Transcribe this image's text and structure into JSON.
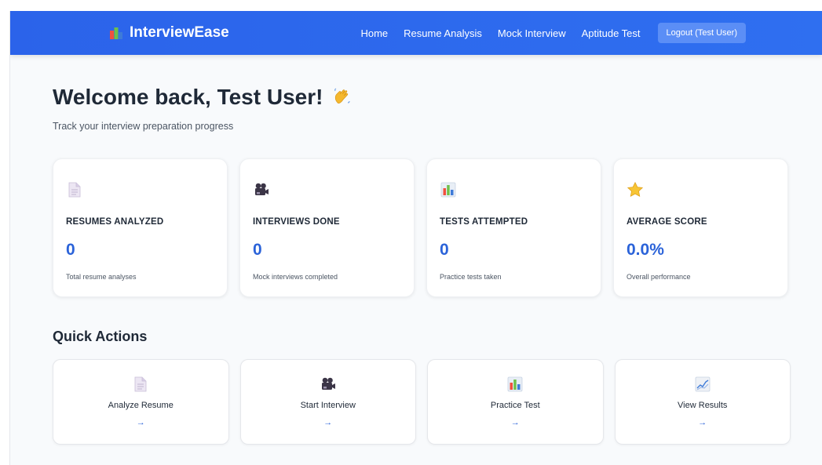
{
  "app": {
    "brand": "InterviewEase",
    "brand_icon": "bar-chart-icon"
  },
  "nav": {
    "links": [
      "Home",
      "Resume Analysis",
      "Mock Interview",
      "Aptitude Test"
    ],
    "logout_label": "Logout (Test User)"
  },
  "header": {
    "welcome": "Welcome back, Test User!",
    "wave_icon": "waving-hand-icon",
    "subtitle": "Track your interview preparation progress"
  },
  "stats": [
    {
      "icon": "document-icon",
      "label": "RESUMES ANALYZED",
      "value": "0",
      "desc": "Total resume analyses"
    },
    {
      "icon": "video-camera-icon",
      "label": "INTERVIEWS DONE",
      "value": "0",
      "desc": "Mock interviews completed"
    },
    {
      "icon": "bar-chart-icon",
      "label": "TESTS ATTEMPTED",
      "value": "0",
      "desc": "Practice tests taken"
    },
    {
      "icon": "star-icon",
      "label": "AVERAGE SCORE",
      "value": "0.0%",
      "desc": "Overall performance"
    }
  ],
  "quick_actions": {
    "title": "Quick Actions",
    "items": [
      {
        "icon": "document-icon",
        "label": "Analyze Resume",
        "arrow": "→"
      },
      {
        "icon": "video-camera-icon",
        "label": "Start Interview",
        "arrow": "→"
      },
      {
        "icon": "bar-chart-icon",
        "label": "Practice Test",
        "arrow": "→"
      },
      {
        "icon": "trend-chart-icon",
        "label": "View Results",
        "arrow": "→"
      }
    ]
  },
  "colors": {
    "navbar": "#2b63ea",
    "accent": "#2b63d9",
    "logout_button": "#5b8ef6",
    "background": "#f8fafc"
  }
}
